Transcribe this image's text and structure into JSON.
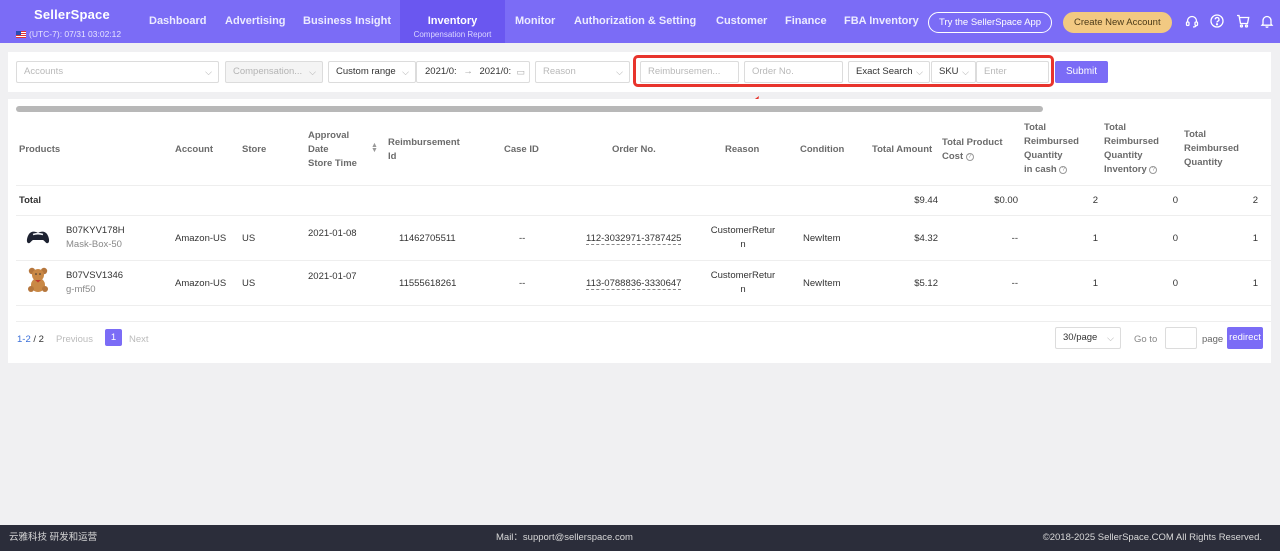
{
  "header": {
    "brand": "SellerSpace",
    "timezone": "(UTC-7): 07/31 03:02:12",
    "nav": [
      {
        "label": "Dashboard"
      },
      {
        "label": "Advertising"
      },
      {
        "label": "Business Insight"
      },
      {
        "label": "Inventory",
        "sub": "Compensation Report",
        "active": true
      },
      {
        "label": "Monitor"
      },
      {
        "label": "Authorization & Setting"
      },
      {
        "label": "Customer"
      },
      {
        "label": "Finance"
      },
      {
        "label": "FBA Inventory"
      }
    ],
    "try_app": "Try the SellerSpace App",
    "create_account": "Create New Account",
    "icons": [
      "headset-icon",
      "help-icon",
      "cart-icon",
      "bell-icon"
    ]
  },
  "filters": {
    "accounts_placeholder": "Accounts",
    "compensation_placeholder": "Compensation...",
    "range": "Custom range",
    "date_from": "2021/0:",
    "date_sep": "→",
    "date_to": "2021/0:",
    "reason_placeholder": "Reason",
    "reimbursement_placeholder": "Reimbursemen...",
    "order_placeholder": "Order No.",
    "search_mode": "Exact Search",
    "search_field": "SKU",
    "search_placeholder": "Enter",
    "submit": "Submit"
  },
  "table": {
    "headers": {
      "products": "Products",
      "account": "Account",
      "store": "Store",
      "approval": [
        "Approval",
        "Date",
        "Store Time"
      ],
      "reimbursement_id": [
        "Reimbursement",
        "Id"
      ],
      "case_id": "Case ID",
      "order_no": "Order No.",
      "reason": "Reason",
      "condition": "Condition",
      "total_amount": "Total Amount",
      "total_cost": [
        "Total Product",
        "Cost"
      ],
      "qty_cash": [
        "Total",
        "Reimbursed",
        "Quantity",
        "in cash"
      ],
      "qty_inventory": [
        "Total",
        "Reimbursed",
        "Quantity",
        "Inventory"
      ],
      "qty_total": [
        "Total",
        "Reimbursed",
        "Quantity"
      ]
    },
    "total_row": {
      "label": "Total",
      "total_amount": "$9.44",
      "total_cost": "$0.00",
      "qty_cash": "2",
      "qty_inventory": "0",
      "qty_total": "2"
    },
    "rows": [
      {
        "asin": "B07KYV178H",
        "sku": "Mask-Box-50",
        "account": "Amazon-US",
        "store": "US",
        "date": "2021-01-08",
        "reimbursement_id": "11462705511",
        "case_id": "--",
        "order_no": "112-3032971-3787425",
        "reason": [
          "CustomerRetur",
          "n"
        ],
        "condition": "NewItem",
        "total_amount": "$4.32",
        "total_cost": "--",
        "qty_cash": "1",
        "qty_inventory": "0",
        "qty_total": "1"
      },
      {
        "asin": "B07VSV1346",
        "sku": "g-mf50",
        "account": "Amazon-US",
        "store": "US",
        "date": "2021-01-07",
        "reimbursement_id": "11555618261",
        "case_id": "--",
        "order_no": "113-0788836-3330647",
        "reason": [
          "CustomerRetur",
          "n"
        ],
        "condition": "NewItem",
        "total_amount": "$5.12",
        "total_cost": "--",
        "qty_cash": "1",
        "qty_inventory": "0",
        "qty_total": "1"
      }
    ]
  },
  "pagination": {
    "range": "1-2",
    "sep": " / ",
    "total": "2",
    "previous": "Previous",
    "current": "1",
    "next": "Next",
    "per_page": "30/page",
    "goto": "Go to",
    "page": "page",
    "redirect": "redirect"
  },
  "footer": {
    "left": "云雅科技 研发和运营",
    "mail": "Mail：support@sellerspace.com",
    "copyright": "©2018-2025 SellerSpace.COM All Rights Reserved."
  },
  "colors": {
    "primary": "#7b6cf6",
    "active_nav": "#6a57f0",
    "highlight": "#e8342c",
    "accent_button": "#f2c982",
    "footer_bg": "#2b2d3a"
  }
}
